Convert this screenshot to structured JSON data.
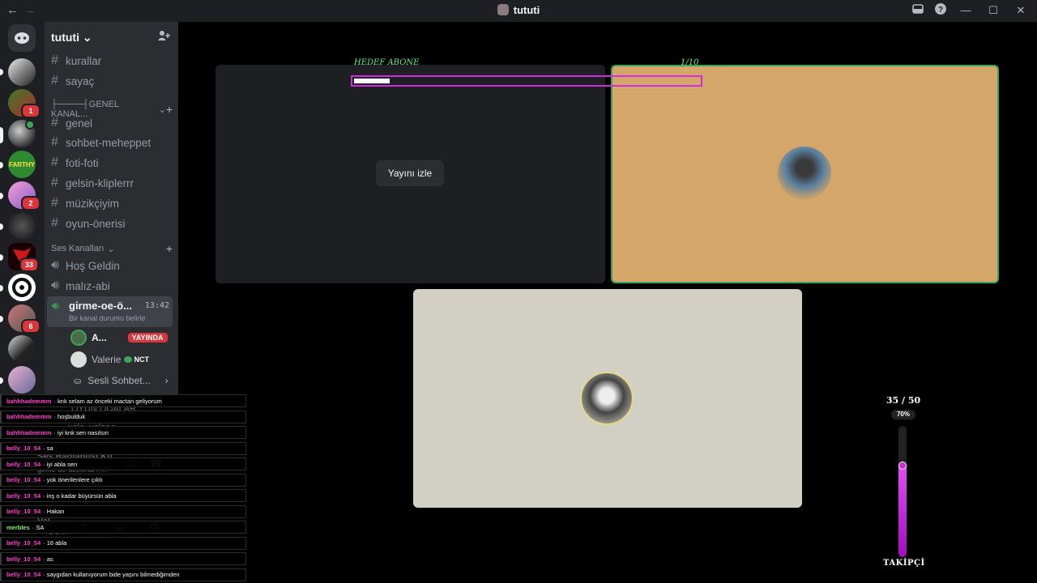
{
  "window": {
    "title": "tututi",
    "back": "←",
    "forward": "→"
  },
  "server": {
    "name": "tututi",
    "chevron": "⌄"
  },
  "servers": [
    {
      "badge": ""
    },
    {
      "badge": "1"
    },
    {
      "badge": ""
    },
    {
      "badge": ""
    },
    {
      "badge": "2"
    },
    {
      "badge": ""
    },
    {
      "badge": "33"
    },
    {
      "badge": ""
    },
    {
      "badge": "6"
    },
    {
      "badge": ""
    },
    {
      "badge": ""
    }
  ],
  "channels": {
    "top": [
      {
        "name": "kurallar"
      },
      {
        "name": "sayaç"
      }
    ],
    "cat1": "├────┤GENEL KANAL...",
    "general": [
      {
        "name": "genel"
      },
      {
        "name": "sohbet-meheppet"
      },
      {
        "name": "foti-foti"
      },
      {
        "name": "gelsin-kliplerrr"
      },
      {
        "name": "müzikçiyim"
      },
      {
        "name": "oyun-önerisi"
      }
    ],
    "cat2": "Ses Kanalları",
    "voice": [
      {
        "name": "Hoş Geldin"
      },
      {
        "name": "malız-abi"
      }
    ],
    "active": {
      "name": "girme-oe-ö...",
      "time": "13:42",
      "status": "Bir kanal durumu belirle"
    },
    "users": [
      {
        "name": "A...",
        "tag": "YAYINDA"
      },
      {
        "name": "Valerie",
        "tag": "NCT"
      }
    ],
    "activity": "Sesli Sohbet..."
  },
  "stream": {
    "watch_label": "Yayını izle",
    "goal_label": "HEDEF ABONE",
    "goal_count": "1/10",
    "goal_progress": 0.1
  },
  "chat": [
    {
      "user": "bahhhademmm",
      "text": "knk selam az önceki mactan geliyorum"
    },
    {
      "user": "bahhhademmm",
      "text": "hoşbulduk"
    },
    {
      "user": "bahhhademmm",
      "text": "iyi knk sen nasılsın"
    },
    {
      "user": "belly_10_54",
      "text": "sa"
    },
    {
      "user": "belly_10_54",
      "text": "iyi abla sen"
    },
    {
      "user": "belly_10_54",
      "text": "yok önerilenlere çıktı"
    },
    {
      "user": "belly_10_54",
      "text": "inş o kadar büyürsün abla"
    },
    {
      "user": "belly_10_54",
      "text": "Hakan"
    },
    {
      "user": "merbles",
      "text": "SA",
      "green": true
    },
    {
      "user": "belly_10_54",
      "text": "16 abla"
    },
    {
      "user": "belly_10_54",
      "text": "as"
    },
    {
      "user": "belly_10_54",
      "text": "saygıdan kullanıyorum bide yaşını bilmediğimden"
    }
  ],
  "ghost": {
    "cat": "OYUN ODALAR...",
    "voice": "velo_valooo",
    "conn": "Ses Bağlantısı Ku",
    "conn_sub": "girme-oe-özelimiz / ...",
    "user": "Val...",
    "user_sub": "₺ 3 ℍ"
  },
  "followers": {
    "count": "35 / 50",
    "percent": "70%",
    "progress": 0.7,
    "label": "TAKİPÇİ"
  },
  "colors": {
    "accent": "#d126e3",
    "tile_orange": "#d4a66a",
    "tile_gray": "#d2cfc5",
    "speaking": "#3ba55c"
  }
}
